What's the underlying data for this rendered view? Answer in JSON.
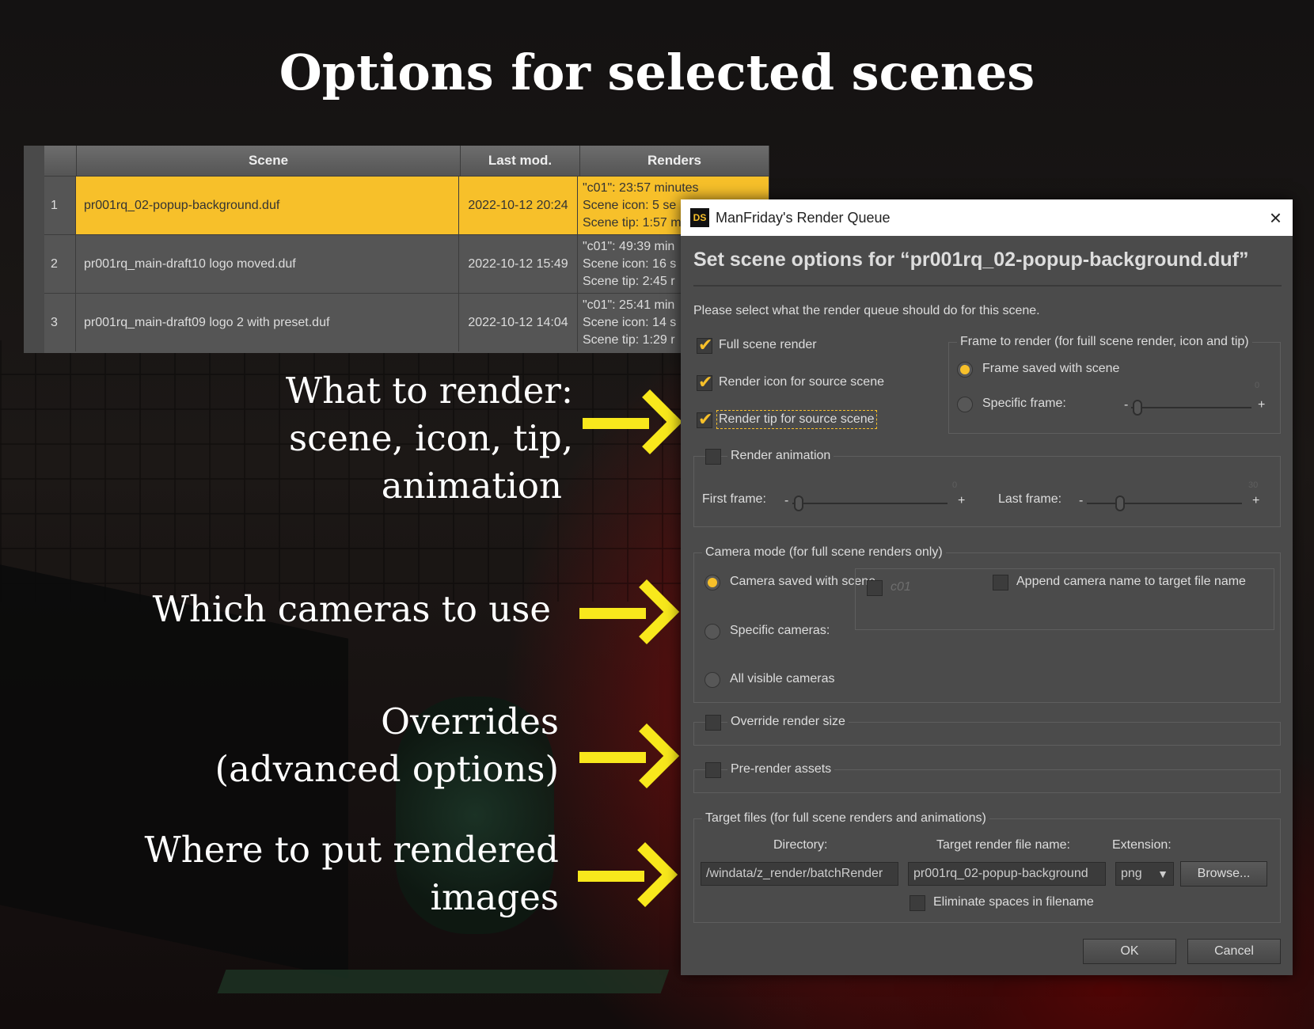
{
  "slide": {
    "title": "Options for selected scenes",
    "annotations": {
      "what": [
        "What to render:",
        "scene, icon, tip,",
        "animation"
      ],
      "cameras": [
        "Which cameras to use"
      ],
      "overrides": [
        "Overrides",
        "(advanced options)"
      ],
      "where": [
        "Where to put rendered",
        "images"
      ]
    }
  },
  "scene_table": {
    "columns": {
      "scene": "Scene",
      "last_mod": "Last mod.",
      "renders": "Renders"
    },
    "rows": [
      {
        "num": "1",
        "scene": "pr001rq_02-popup-background.duf",
        "last_mod": "2022-10-12 20:24",
        "renders": [
          "\"c01\": 23:57 minutes",
          "Scene icon: 5 se",
          "Scene tip: 1:57 m"
        ]
      },
      {
        "num": "2",
        "scene": "pr001rq_main-draft10 logo moved.duf",
        "last_mod": "2022-10-12 15:49",
        "renders": [
          "\"c01\": 49:39 min",
          "Scene icon: 16 s",
          "Scene tip: 2:45 r"
        ]
      },
      {
        "num": "3",
        "scene": "pr001rq_main-draft09 logo 2 with preset.duf",
        "last_mod": "2022-10-12 14:04",
        "renders": [
          "\"c01\": 25:41 min",
          "Scene icon: 14 s",
          "Scene tip: 1:29 r"
        ]
      }
    ]
  },
  "dialog": {
    "logo": "DS",
    "title": "ManFriday's Render Queue",
    "close": "×",
    "heading": "Set scene options for “pr001rq_02-popup-background.duf”",
    "intro": "Please select what the render queue should do for this scene.",
    "full_scene_render": "Full scene render",
    "render_icon": "Render icon for source scene",
    "render_tip": "Render tip for source scene",
    "frame_group": "Frame to render (for fuill scene render, icon and tip)",
    "frame_saved": "Frame saved with scene",
    "specific_frame": "Specific frame:",
    "specific_frame_value": "0",
    "render_animation": "Render animation",
    "first_frame": "First frame:",
    "first_frame_value": "0",
    "last_frame": "Last frame:",
    "last_frame_value": "30",
    "camera_group": "Camera mode (for full scene renders only)",
    "camera_saved": "Camera saved with scene",
    "append_camera": "Append camera name to target file name",
    "specific_cameras": "Specific cameras:",
    "camera_list": [
      "c01"
    ],
    "all_visible": "All visible cameras",
    "override_size": "Override render size",
    "pre_render": "Pre-render assets",
    "target_group": "Target files (for full scene renders and animations)",
    "directory_label": "Directory:",
    "directory_value": "/windata/z_render/batchRender",
    "filename_label": "Target render file name:",
    "filename_value": "pr001rq_02-popup-background",
    "extension_label": "Extension:",
    "extension_value": "png",
    "browse": "Browse...",
    "eliminate_spaces": "Eliminate spaces in filename",
    "ok": "OK",
    "cancel": "Cancel",
    "minus": "-",
    "plus": "+"
  },
  "colors": {
    "accent": "#f7c02a",
    "arrow": "#f8e81c"
  }
}
